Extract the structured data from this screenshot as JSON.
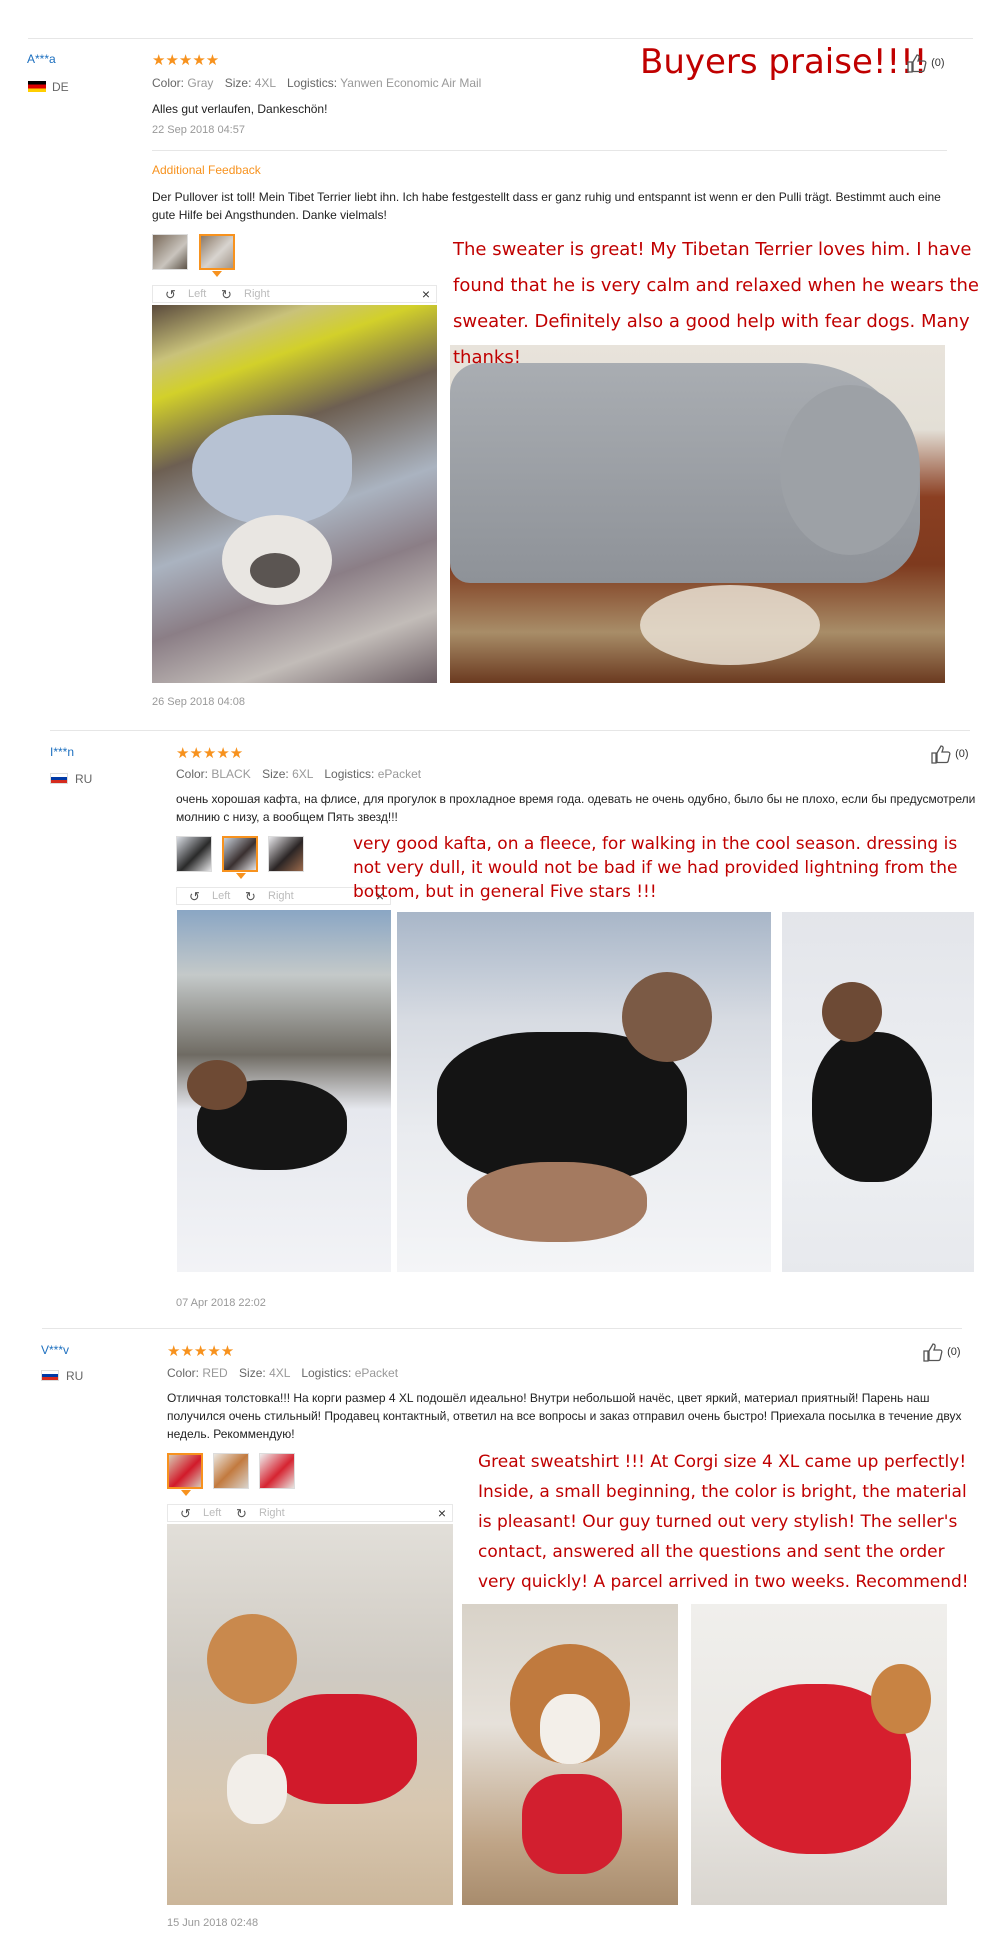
{
  "headline": "Buyers praise!!!!",
  "reviews": [
    {
      "user": "A***a",
      "country": "DE",
      "stars": "★★★★★",
      "color_label": "Color:",
      "color": "Gray",
      "size_label": "Size:",
      "size": "4XL",
      "logistics_label": "Logistics:",
      "logistics": "Yanwen Economic Air Mail",
      "text": "Alles gut verlaufen, Dankeschön!",
      "date": "22 Sep 2018 04:57",
      "additional_label": "Additional Feedback",
      "additional_text": "Der Pullover ist toll! Mein Tibet Terrier liebt ihn. Ich habe festgestellt dass er ganz ruhig und entspannt ist wenn er den Pulli trägt. Bestimmt auch eine gute Hilfe bei Angsthunden. Danke vielmals!",
      "additional_date": "26 Sep 2018 04:08",
      "likes": "(0)",
      "rotate_left": "Left",
      "rotate_right": "Right",
      "close": "×",
      "translation": "The sweater is great! My Tibetan Terrier loves him. I have found that he is very calm and relaxed when he wears the sweater. Definitely also a good help with fear dogs. Many thanks!"
    },
    {
      "user": "I***n",
      "country": "RU",
      "stars": "★★★★★",
      "color_label": "Color:",
      "color": "BLACK",
      "size_label": "Size:",
      "size": "6XL",
      "logistics_label": "Logistics:",
      "logistics": "ePacket",
      "text": "очень хорошая кафта, на флисе, для прогулок в прохладное время года. одевать не очень одубно, было бы не плохо, если бы предусмотрели молнию с низу, а вообщем Пять звезд!!!",
      "date": "07 Apr 2018 22:02",
      "likes": "(0)",
      "rotate_left": "Left",
      "rotate_right": "Right",
      "close": "×",
      "translation": "very good kafta, on a fleece, for walking in the cool season. dressing is not very dull, it would not be bad if we had provided lightning from the bottom, but in general Five stars !!!"
    },
    {
      "user": "V***v",
      "country": "RU",
      "stars": "★★★★★",
      "color_label": "Color:",
      "color": "RED",
      "size_label": "Size:",
      "size": "4XL",
      "logistics_label": "Logistics:",
      "logistics": "ePacket",
      "text": "Отличная толстовка!!! На корги размер 4 XL подошёл идеально! Внутри небольшой начёс, цвет яркий, материал приятный! Парень наш получился очень стильный! Продавец контактный, ответил на все вопросы и заказ отправил очень быстро! Приехала посылка в течение двух недель. Рекоммендую!",
      "date": "15 Jun 2018 02:48",
      "likes": "(0)",
      "rotate_left": "Left",
      "rotate_right": "Right",
      "close": "×",
      "translation": "Great sweatshirt !!! At Corgi size 4 XL came up perfectly! Inside, a small beginning, the color is bright, the material is pleasant! Our guy turned out very stylish! The seller's contact, answered all the questions and sent the order very quickly! A parcel arrived in two weeks. Recommend!"
    }
  ]
}
